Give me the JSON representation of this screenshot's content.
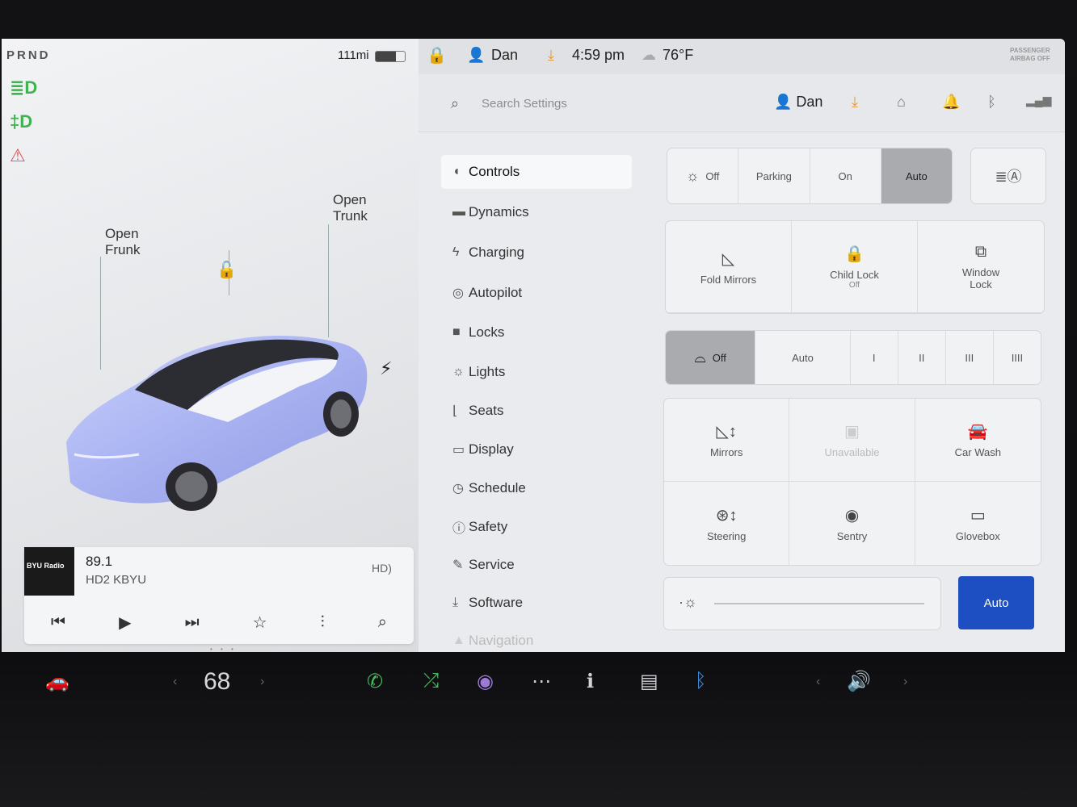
{
  "status": {
    "gear": "PRND",
    "range": "111mi",
    "user": "Dan",
    "time": "4:59 pm",
    "temperature": "76°F",
    "airbag_line1": "PASSENGER",
    "airbag_line2": "AIRBAG OFF"
  },
  "car": {
    "frunk_label_1": "Open",
    "frunk_label_2": "Frunk",
    "trunk_label_1": "Open",
    "trunk_label_2": "Trunk"
  },
  "media": {
    "logo": "BYU Radio",
    "station": "89.1",
    "sub": "HD2 KBYU",
    "page_dots": "• • •"
  },
  "search": {
    "placeholder": "Search Settings"
  },
  "header": {
    "user": "Dan"
  },
  "nav": [
    {
      "label": "Controls",
      "icon": "toggle-icon"
    },
    {
      "label": "Dynamics",
      "icon": "car-icon"
    },
    {
      "label": "Charging",
      "icon": "bolt-icon"
    },
    {
      "label": "Autopilot",
      "icon": "steering-wheel-icon"
    },
    {
      "label": "Locks",
      "icon": "lock-icon"
    },
    {
      "label": "Lights",
      "icon": "sun-icon"
    },
    {
      "label": "Seats",
      "icon": "seat-icon"
    },
    {
      "label": "Display",
      "icon": "display-icon"
    },
    {
      "label": "Schedule",
      "icon": "clock-icon"
    },
    {
      "label": "Safety",
      "icon": "info-icon"
    },
    {
      "label": "Service",
      "icon": "wrench-icon"
    },
    {
      "label": "Software",
      "icon": "download-icon"
    },
    {
      "label": "Navigation",
      "icon": "nav-arrow-icon"
    }
  ],
  "lights_row": {
    "options": [
      "Off",
      "Parking",
      "On",
      "Auto"
    ],
    "selected": "Auto"
  },
  "tiles_row1": [
    {
      "label": "Fold Mirrors",
      "sub": ""
    },
    {
      "label": "Child Lock",
      "sub": "Off"
    },
    {
      "label": "Window Lock",
      "sub": ""
    }
  ],
  "wipers": {
    "options": [
      "Off",
      "Auto",
      "I",
      "II",
      "III",
      "IIII"
    ],
    "selected": "Off"
  },
  "tiles_grid": [
    {
      "label": "Mirrors"
    },
    {
      "label": "Unavailable"
    },
    {
      "label": "Car Wash"
    },
    {
      "label": "Steering"
    },
    {
      "label": "Sentry"
    },
    {
      "label": "Glovebox"
    }
  ],
  "brightness": {
    "auto_label": "Auto",
    "level": 0.0
  },
  "dock": {
    "temperature": "68"
  },
  "colors": {
    "accent_blue": "#1d4fc2",
    "indicator_green": "#3fb34f",
    "indicator_red": "#e34d4d",
    "download_orange": "#e39a3b"
  }
}
